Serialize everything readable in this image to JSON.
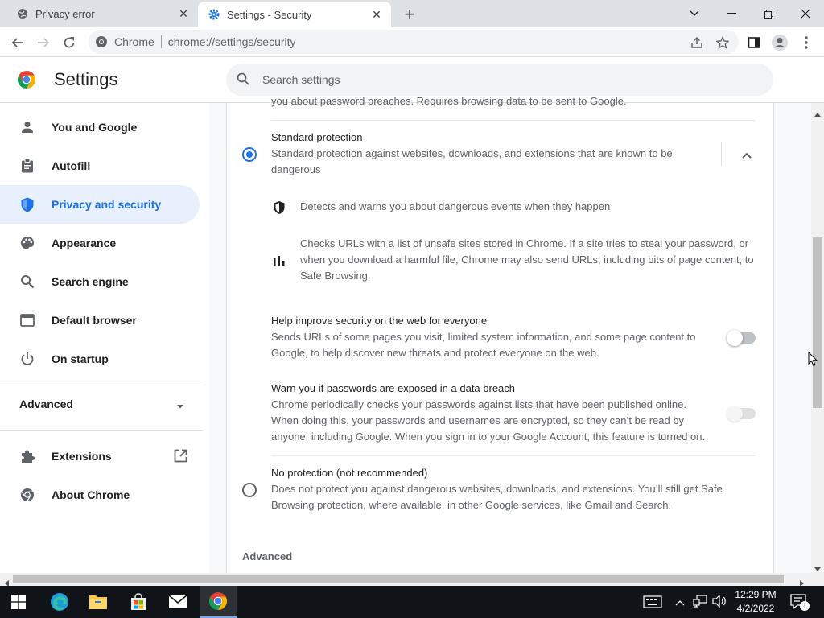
{
  "browser": {
    "tabs": [
      {
        "title": "Privacy error",
        "active": false
      },
      {
        "title": "Settings - Security",
        "active": true
      }
    ],
    "omnibox": {
      "chip": "Chrome",
      "url": "chrome://settings/security"
    }
  },
  "settings": {
    "title": "Settings",
    "search_placeholder": "Search settings"
  },
  "sidebar": {
    "items": [
      {
        "label": "You and Google",
        "icon": "person-icon"
      },
      {
        "label": "Autofill",
        "icon": "clipboard-icon"
      },
      {
        "label": "Privacy and security",
        "icon": "shield-icon",
        "selected": true
      },
      {
        "label": "Appearance",
        "icon": "palette-icon"
      },
      {
        "label": "Search engine",
        "icon": "search-icon"
      },
      {
        "label": "Default browser",
        "icon": "browser-icon"
      },
      {
        "label": "On startup",
        "icon": "power-icon"
      }
    ],
    "advanced": "Advanced",
    "extensions": "Extensions",
    "about": "About Chrome"
  },
  "main": {
    "top_cut_text": "you about password breaches. Requires browsing data to be sent to Google.",
    "standard": {
      "title": "Standard protection",
      "desc_line1": "Standard protection against websites, downloads, and extensions that are known to be",
      "desc_line2": "dangerous",
      "checked": true
    },
    "feature1": "Detects and warns you about dangerous events when they happen",
    "feature2_lines": [
      "Checks URLs with a list of unsafe sites stored in Chrome. If a site tries to steal your password, or",
      "when you download a harmful file, Chrome may also send URLs, including bits of page content, to",
      "Safe Browsing."
    ],
    "help": {
      "title": "Help improve security on the web for everyone",
      "lines": [
        "Sends URLs of some pages you visit, limited system information, and some page content to",
        "Google, to help discover new threats and protect everyone on the web."
      ],
      "enabled": false
    },
    "warn": {
      "title": "Warn you if passwords are exposed in a data breach",
      "lines": [
        "Chrome periodically checks your passwords against lists that have been published online.",
        "When doing this, your passwords and usernames are encrypted, so they can’t be read by",
        "anyone, including Google. When you sign in to your Google Account, this feature is turned on."
      ],
      "enabled": false
    },
    "none": {
      "title": "No protection (not recommended)",
      "lines": [
        "Does not protect you against dangerous websites, downloads, and extensions. You’ll still get Safe",
        "Browsing protection, where available, in other Google services, like Gmail and Search."
      ],
      "checked": false
    },
    "advanced_heading": "Advanced"
  },
  "taskbar": {
    "time": "12:29 PM",
    "date": "4/2/2022",
    "notification_count": "1"
  }
}
